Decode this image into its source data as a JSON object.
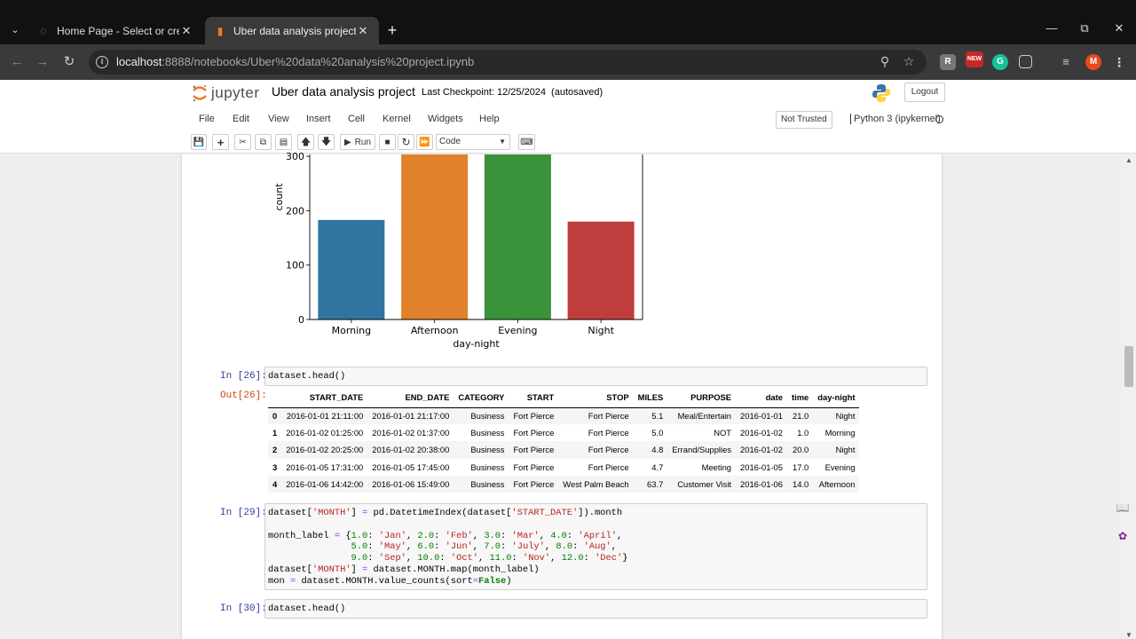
{
  "browser": {
    "tabs": [
      {
        "title": "Home Page - Select or create a",
        "active": false
      },
      {
        "title": "Uber data analysis project - Jup",
        "active": true
      }
    ],
    "url_host": "localhost",
    "url_rest": ":8888/notebooks/Uber%20data%20analysis%20project.ipynb",
    "profile_initial": "M",
    "new_badge": "NEW"
  },
  "jupyter": {
    "logo_text": "jupyter",
    "notebook_title": "Uber data analysis project",
    "checkpoint": "Last Checkpoint: 12/25/2024",
    "save_status": "(autosaved)",
    "logout_label": "Logout",
    "menu": [
      "File",
      "Edit",
      "View",
      "Insert",
      "Cell",
      "Kernel",
      "Widgets",
      "Help"
    ],
    "trust_label": "Not Trusted",
    "kernel_label": "Python 3 (ipykernel)",
    "toolbar": {
      "run_label": "Run",
      "cell_type": "Code"
    }
  },
  "chart_data": {
    "type": "bar",
    "categories": [
      "Morning",
      "Afternoon",
      "Evening",
      "Night"
    ],
    "values": [
      183,
      310,
      310,
      180
    ],
    "xlabel": "day-night",
    "ylabel": "count",
    "yticks": [
      0,
      100,
      200,
      300
    ],
    "ylim": [
      0,
      300
    ],
    "colors": [
      "#3274a1",
      "#e1812c",
      "#3a923a",
      "#c03d3e"
    ]
  },
  "cells": {
    "c26": {
      "in_prompt": "In [26]:",
      "out_prompt": "Out[26]:",
      "code": "dataset.head()"
    },
    "c29": {
      "in_prompt": "In [29]:"
    },
    "c30": {
      "in_prompt": "In [30]:",
      "code": "dataset.head()"
    }
  },
  "table": {
    "columns": [
      "",
      "START_DATE",
      "END_DATE",
      "CATEGORY",
      "START",
      "STOP",
      "MILES",
      "PURPOSE",
      "date",
      "time",
      "day-night"
    ],
    "rows": [
      [
        "0",
        "2016-01-01 21:11:00",
        "2016-01-01 21:17:00",
        "Business",
        "Fort Pierce",
        "Fort Pierce",
        "5.1",
        "Meal/Entertain",
        "2016-01-01",
        "21.0",
        "Night"
      ],
      [
        "1",
        "2016-01-02 01:25:00",
        "2016-01-02 01:37:00",
        "Business",
        "Fort Pierce",
        "Fort Pierce",
        "5.0",
        "NOT",
        "2016-01-02",
        "1.0",
        "Morning"
      ],
      [
        "2",
        "2016-01-02 20:25:00",
        "2016-01-02 20:38:00",
        "Business",
        "Fort Pierce",
        "Fort Pierce",
        "4.8",
        "Errand/Supplies",
        "2016-01-02",
        "20.0",
        "Night"
      ],
      [
        "3",
        "2016-01-05 17:31:00",
        "2016-01-05 17:45:00",
        "Business",
        "Fort Pierce",
        "Fort Pierce",
        "4.7",
        "Meeting",
        "2016-01-05",
        "17.0",
        "Evening"
      ],
      [
        "4",
        "2016-01-06 14:42:00",
        "2016-01-06 15:49:00",
        "Business",
        "Fort Pierce",
        "West Palm Beach",
        "63.7",
        "Customer Visit",
        "2016-01-06",
        "14.0",
        "Afternoon"
      ]
    ]
  }
}
